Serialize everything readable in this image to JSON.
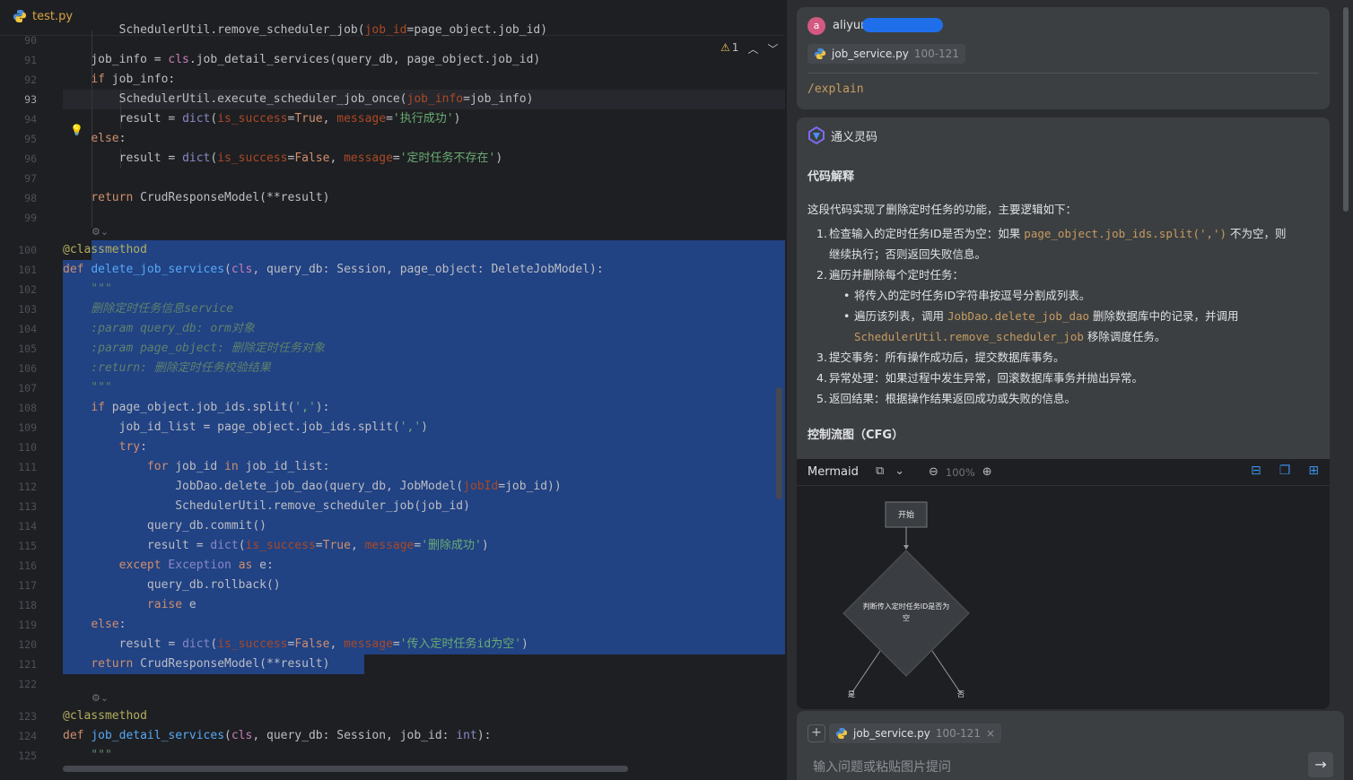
{
  "editor": {
    "tab_label": "test.py",
    "inspection_count": "1",
    "lines": [
      {
        "n": "90"
      },
      {
        "n": "91"
      },
      {
        "n": "92"
      },
      {
        "n": "93"
      },
      {
        "n": "94"
      },
      {
        "n": "95"
      },
      {
        "n": "96"
      },
      {
        "n": "97"
      },
      {
        "n": "98"
      },
      {
        "n": "99"
      },
      {
        "n": "100"
      },
      {
        "n": "101"
      },
      {
        "n": "102"
      },
      {
        "n": "103"
      },
      {
        "n": "104"
      },
      {
        "n": "105"
      },
      {
        "n": "106"
      },
      {
        "n": "107"
      },
      {
        "n": "108"
      },
      {
        "n": "109"
      },
      {
        "n": "110"
      },
      {
        "n": "111"
      },
      {
        "n": "112"
      },
      {
        "n": "113"
      },
      {
        "n": "114"
      },
      {
        "n": "115"
      },
      {
        "n": "116"
      },
      {
        "n": "117"
      },
      {
        "n": "118"
      },
      {
        "n": "119"
      },
      {
        "n": "120"
      },
      {
        "n": "121"
      },
      {
        "n": "122"
      },
      {
        "n": "123"
      },
      {
        "n": "124"
      },
      {
        "n": "125"
      }
    ],
    "code": {
      "l90": "        SchedulerUtil.remove_scheduler_job(job_id=page_object.job_id)",
      "l91": "    job_info = cls.job_detail_services(query_db, page_object.job_id)",
      "l92": "    if job_info:",
      "l93": "        SchedulerUtil.execute_scheduler_job_once(job_info=job_info)",
      "l94": "        result = dict(is_success=True, message='执行成功')",
      "l95": "    else:",
      "l96": "        result = dict(is_success=False, message='定时任务不存在')",
      "l98": "    return CrudResponseModel(**result)",
      "l100": "@classmethod",
      "l101": "def delete_job_services(cls, query_db: Session, page_object: DeleteJobModel):",
      "l102": "    \"\"\"",
      "l103": "    删除定时任务信息service",
      "l104": "    :param query_db: orm对象",
      "l105": "    :param page_object: 删除定时任务对象",
      "l106": "    :return: 删除定时任务校验结果",
      "l107": "    \"\"\"",
      "l108": "    if page_object.job_ids.split(','):",
      "l109": "        job_id_list = page_object.job_ids.split(',')",
      "l110": "        try:",
      "l111": "            for job_id in job_id_list:",
      "l112": "                JobDao.delete_job_dao(query_db, JobModel(jobId=job_id))",
      "l113": "                SchedulerUtil.remove_scheduler_job(job_id)",
      "l114": "            query_db.commit()",
      "l115": "            result = dict(is_success=True, message='删除成功')",
      "l116": "        except Exception as e:",
      "l117": "            query_db.rollback()",
      "l118": "            raise e",
      "l119": "    else:",
      "l120": "        result = dict(is_success=False, message='传入定时任务id为空')",
      "l121": "    return CrudResponseModel(**result)",
      "l123": "@classmethod",
      "l124": "def job_detail_services(cls, query_db: Session, job_id: int):",
      "l125": "    \"\"\""
    }
  },
  "assistant": {
    "user": {
      "avatar_letter": "a",
      "name": "aliyun",
      "file_chip": {
        "name": "job_service.py",
        "range": "100-121"
      },
      "command": "/explain"
    },
    "ai": {
      "name": "通义灵码",
      "section1_title": "代码解释",
      "intro": "这段代码实现了删除定时任务的功能，主要逻辑如下：",
      "steps": {
        "s1_num": "1.",
        "s1_a": "检查输入的定时任务ID是否为空：如果 ",
        "s1_code": "page_object.job_ids.split(',')",
        "s1_b": " 不为空，则",
        "s1_c": "继续执行；否则返回失败信息。",
        "s2_num": "2.",
        "s2": "遍历并删除每个定时任务：",
        "s2_b1": "将传入的定时任务ID字符串按逗号分割成列表。",
        "s2_b2_a": "遍历该列表，调用 ",
        "s2_b2_code1": "JobDao.delete_job_dao",
        "s2_b2_b": " 删除数据库中的记录，并调用",
        "s2_b2_code2": "SchedulerUtil.remove_scheduler_job",
        "s2_b2_c": " 移除调度任务。",
        "s3_num": "3.",
        "s3": "提交事务：所有操作成功后，提交数据库事务。",
        "s4_num": "4.",
        "s4": "异常处理：如果过程中发生异常，回滚数据库事务并抛出异常。",
        "s5_num": "5.",
        "s5": "返回结果：根据操作结果返回成功或失败的信息。",
        "bullet": "•"
      },
      "section2_title": "控制流图（CFG）",
      "mermaid": {
        "title": "Mermaid",
        "zoom": "100%",
        "nodes": {
          "start": "开始",
          "decision_line1": "判断传入定时任务ID是否为",
          "decision_line2": "空",
          "yes": "是",
          "no": "否"
        }
      }
    },
    "input": {
      "file_chip": {
        "name": "job_service.py",
        "range": "100-121"
      },
      "placeholder": "输入问题或粘贴图片提问"
    }
  },
  "colors": {
    "selection": "#214283",
    "keyword": "#cf8e6d",
    "string": "#6aab73",
    "function": "#56a8f5",
    "accent_blue": "#3d8fe8",
    "inline_code": "#c69b61"
  }
}
